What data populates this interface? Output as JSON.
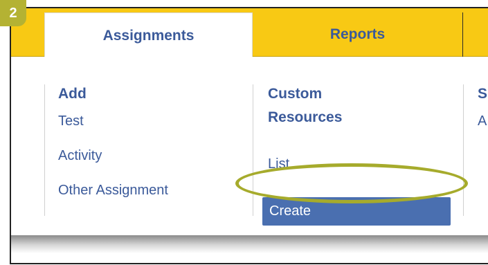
{
  "step_badge": "2",
  "tabs": [
    {
      "label": "Assignments",
      "active": true
    },
    {
      "label": "Reports",
      "active": false
    }
  ],
  "columns": [
    {
      "title": "Add",
      "items": [
        "Test",
        "Activity",
        "Other Assignment"
      ]
    },
    {
      "title_line1": "Custom",
      "title_line2": "Resources",
      "items": [
        "List",
        "Create"
      ],
      "highlighted_item": "Create"
    },
    {
      "title": "S",
      "items": [
        "A"
      ]
    }
  ],
  "colors": {
    "tab_bar": "#f8c914",
    "link_text": "#3b5a9a",
    "selected_item_bg": "#4a6fb0",
    "highlight_ring": "#a6ab2c",
    "badge_bg": "#b4b233"
  }
}
